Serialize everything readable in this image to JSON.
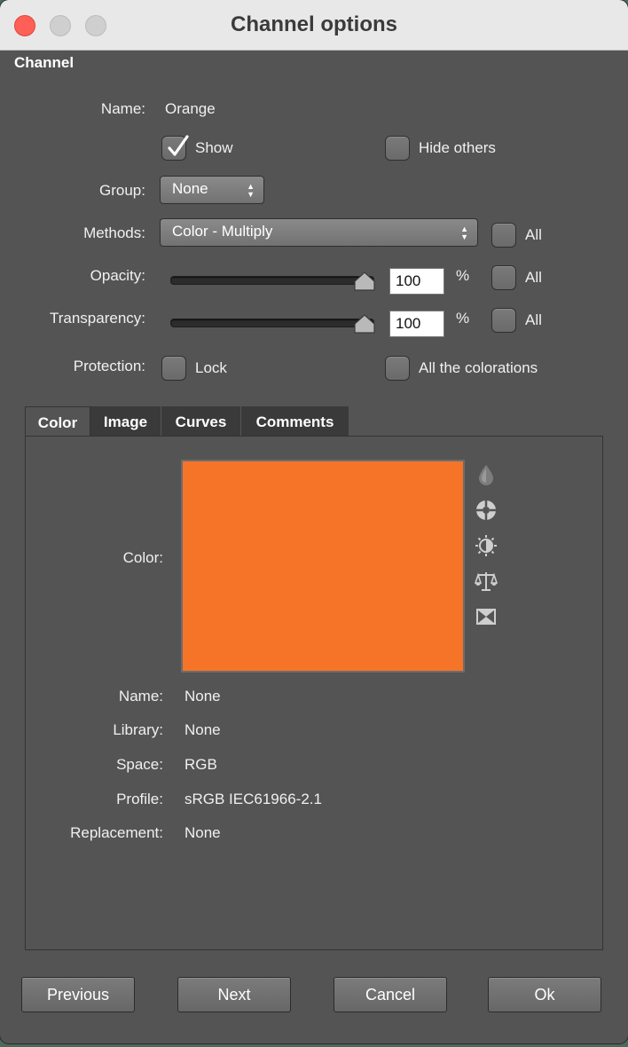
{
  "window": {
    "title": "Channel options"
  },
  "channel": {
    "section_label": "Channel",
    "name_label": "Name:",
    "name_value": "Orange",
    "show_label": "Show",
    "show_checked": true,
    "hide_others_label": "Hide others",
    "hide_others_checked": false,
    "group_label": "Group:",
    "group_value": "None",
    "methods_label": "Methods:",
    "methods_value": "Color - Multiply",
    "all_label": "All",
    "opacity_label": "Opacity:",
    "opacity_value": "100",
    "transparency_label": "Transparency:",
    "transparency_value": "100",
    "percent": "%",
    "protection_label": "Protection:",
    "lock_label": "Lock",
    "all_colorations_label": "All the colorations"
  },
  "tabs": [
    {
      "label": "Color",
      "active": true
    },
    {
      "label": "Image",
      "active": false
    },
    {
      "label": "Curves",
      "active": false
    },
    {
      "label": "Comments",
      "active": false
    }
  ],
  "color_panel": {
    "color_label": "Color:",
    "swatch_color": "#f57428",
    "icons": [
      "drop-icon",
      "color-wheel-icon",
      "brightness-icon",
      "balance-scale-icon",
      "swap-icon"
    ],
    "name_label": "Name:",
    "name_value": "None",
    "library_label": "Library:",
    "library_value": "None",
    "space_label": "Space:",
    "space_value": "RGB",
    "profile_label": "Profile:",
    "profile_value": "sRGB IEC61966-2.1",
    "replacement_label": "Replacement:",
    "replacement_value": "None"
  },
  "buttons": {
    "previous": "Previous",
    "next": "Next",
    "cancel": "Cancel",
    "ok": "Ok"
  }
}
